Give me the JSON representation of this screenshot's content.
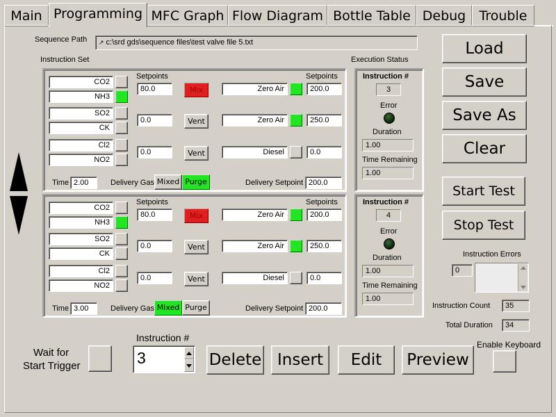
{
  "tabs": [
    "Main",
    "Programming",
    "MFC Graph",
    "Flow Diagram",
    "Bottle Table",
    "Debug",
    "Trouble"
  ],
  "sequence": {
    "label": "Sequence Path",
    "path": "c:\\srd gds\\sequence files\\test valve file 5.txt",
    "icon": "path-icon"
  },
  "instruction_set_label": "Instruction Set",
  "execution_status_label": "Execution Status",
  "blocks": [
    {
      "setpoints_label": "Setpoints",
      "setpoints_label2": "Setpoints",
      "rows": [
        {
          "gas_a": "CO2",
          "gas_b": "NH3",
          "gas_a_on": false,
          "gas_b_on": true,
          "setpoint": "80.0",
          "button": "Mix",
          "button_state": "red",
          "gas_c": "Zero Air",
          "gas_c_on": true,
          "setpoint2": "200.0"
        },
        {
          "gas_a": "SO2",
          "gas_b": "CK",
          "gas_a_on": false,
          "gas_b_on": false,
          "setpoint": "0.0",
          "button": "Vent",
          "button_state": "normal",
          "gas_c": "Zero Air",
          "gas_c_on": true,
          "setpoint2": "250.0"
        },
        {
          "gas_a": "Cl2",
          "gas_b": "NO2",
          "gas_a_on": false,
          "gas_b_on": false,
          "setpoint": "0.0",
          "button": "Vent",
          "button_state": "normal",
          "gas_c": "Diesel",
          "gas_c_on": false,
          "setpoint2": "0.0"
        }
      ],
      "time_label": "Time",
      "time": "2.00",
      "delivery_gas_label": "Delivery Gas",
      "mixed": "Mixed",
      "purge": "Purge",
      "selected": "Purge",
      "delivery_setpoint_label": "Delivery Setpoint",
      "delivery_setpoint": "200.0",
      "status": {
        "instruction_label": "Instruction #",
        "instruction": "3",
        "error_label": "Error",
        "duration_label": "Duration",
        "duration": "1.00",
        "remaining_label": "Time Remaining",
        "remaining": "1.00"
      }
    },
    {
      "setpoints_label": "Setpoints",
      "setpoints_label2": "Setpoints",
      "rows": [
        {
          "gas_a": "CO2",
          "gas_b": "NH3",
          "gas_a_on": false,
          "gas_b_on": true,
          "setpoint": "80.0",
          "button": "Mix",
          "button_state": "red",
          "gas_c": "Zero Air",
          "gas_c_on": true,
          "setpoint2": "200.0"
        },
        {
          "gas_a": "SO2",
          "gas_b": "CK",
          "gas_a_on": false,
          "gas_b_on": false,
          "setpoint": "0.0",
          "button": "Vent",
          "button_state": "normal",
          "gas_c": "Zero Air",
          "gas_c_on": true,
          "setpoint2": "250.0"
        },
        {
          "gas_a": "Cl2",
          "gas_b": "NO2",
          "gas_a_on": false,
          "gas_b_on": false,
          "setpoint": "0.0",
          "button": "Vent",
          "button_state": "normal",
          "gas_c": "Diesel",
          "gas_c_on": false,
          "setpoint2": "0.0"
        }
      ],
      "time_label": "Time",
      "time": "3.00",
      "delivery_gas_label": "Delivery Gas",
      "mixed": "Mixed",
      "purge": "Purge",
      "selected": "Mixed",
      "delivery_setpoint_label": "Delivery Setpoint",
      "delivery_setpoint": "200.0",
      "status": {
        "instruction_label": "Instruction #",
        "instruction": "4",
        "error_label": "Error",
        "duration_label": "Duration",
        "duration": "1.00",
        "remaining_label": "Time Remaining",
        "remaining": "1.00"
      }
    }
  ],
  "right_buttons": {
    "load": "Load",
    "save": "Save",
    "save_as": "Save As",
    "clear": "Clear",
    "start_test": "Start Test",
    "stop_test": "Stop Test"
  },
  "instruction_errors": {
    "label": "Instruction Errors",
    "index": "0"
  },
  "instruction_count": {
    "label": "Instruction Count",
    "value": "35"
  },
  "total_duration": {
    "label": "Total Duration",
    "value": "34"
  },
  "bottom": {
    "wait_label_1": "Wait for",
    "wait_label_2": "Start Trigger",
    "instruction_label": "Instruction #",
    "instruction_value": "3",
    "delete": "Delete",
    "insert": "Insert",
    "edit": "Edit",
    "preview": "Preview",
    "enable_keyboard": "Enable Keyboard"
  },
  "colors": {
    "background": "#d4d0c8",
    "led_on": "#22e622",
    "mix_button": "#e02020"
  }
}
